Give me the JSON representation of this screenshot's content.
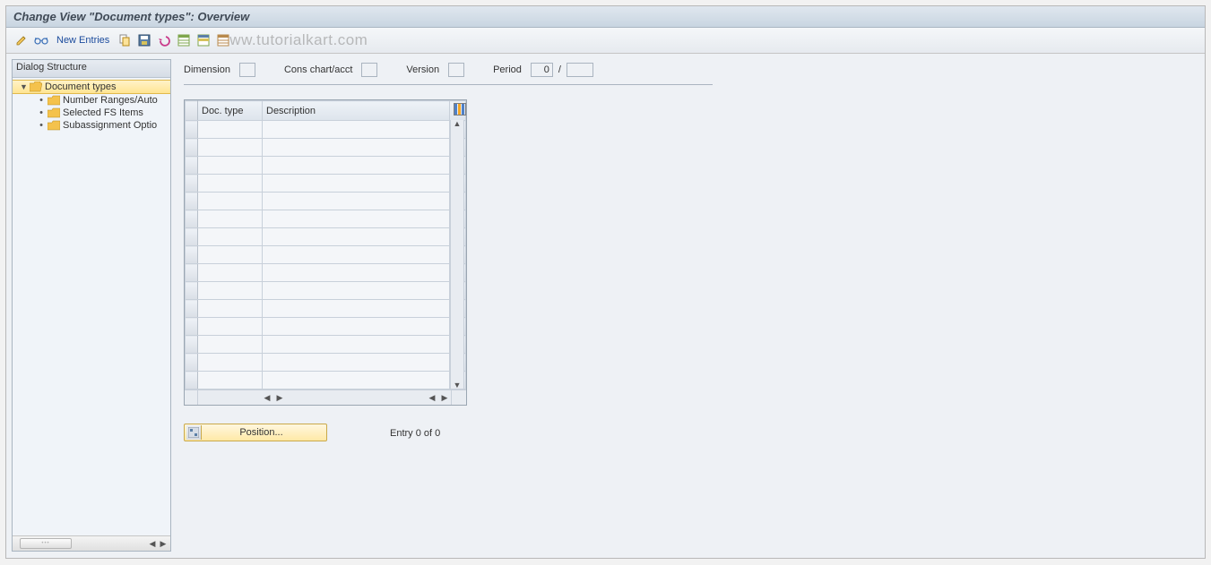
{
  "titlebar": {
    "title": "Change View \"Document types\": Overview"
  },
  "toolbar": {
    "new_entries_label": "New Entries",
    "watermark": "ww.tutorialkart.com"
  },
  "left": {
    "header": "Dialog Structure",
    "root": "Document types",
    "children": [
      "Number Ranges/Auto",
      "Selected FS Items",
      "Subassignment Optio"
    ]
  },
  "filters": {
    "dimension_label": "Dimension",
    "dimension_value": "",
    "conschart_label": "Cons chart/acct",
    "conschart_value": "",
    "version_label": "Version",
    "version_value": "",
    "period_label": "Period",
    "period_value": "0",
    "period_sep": "/",
    "period_sub": ""
  },
  "grid": {
    "col1": "Doc. type",
    "col2": "Description",
    "row_count": 15
  },
  "bottom": {
    "position_label": "Position...",
    "entry_text": "Entry 0 of 0"
  }
}
